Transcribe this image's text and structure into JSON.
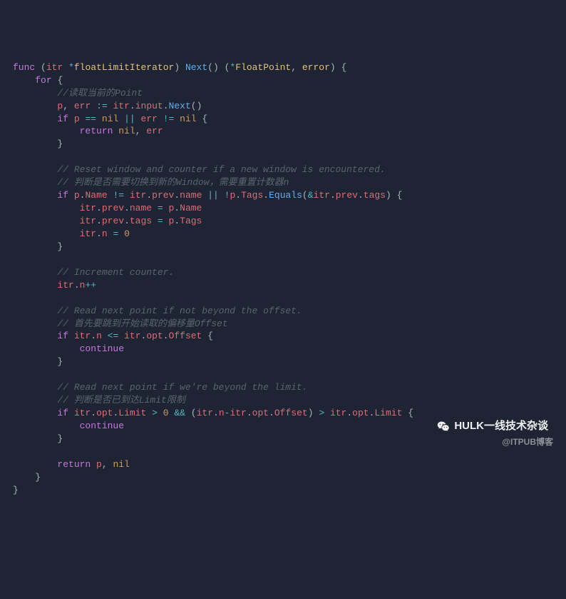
{
  "code": {
    "l01": {
      "func": "func",
      "itr": "itr",
      "star": "*",
      "ty": "floatLimitIterator",
      "next": "Next",
      "lp2": "(",
      "rp2": ")",
      "lpret": "(",
      "star2": "*",
      "tyret": "FloatPoint",
      "comma": ",",
      "err": "error",
      "rpret": ")",
      "ob": "{"
    },
    "l02": {
      "for": "for",
      "ob": "{"
    },
    "l03": {
      "cm": "//读取当前的Point"
    },
    "l04": {
      "p": "p",
      "c1": ",",
      "err": "err",
      "asn": ":=",
      "itr": "itr",
      "d1": ".",
      "input": "input",
      "d2": ".",
      "next": "Next",
      "lp": "(",
      "rp": ")"
    },
    "l05": {
      "if": "if",
      "p": "p",
      "eq": "==",
      "nil1": "nil",
      "or": "||",
      "err": "err",
      "neq": "!=",
      "nil2": "nil",
      "ob": "{"
    },
    "l06": {
      "ret": "return",
      "nil": "nil",
      "c": ",",
      "err": "err"
    },
    "l07": {
      "cb": "}"
    },
    "l09": {
      "cm": "// Reset window and counter if a new window is encountered."
    },
    "l10": {
      "cm": "// 判断是否需要切换到新的Window，需要重置计数器n"
    },
    "l11": {
      "if": "if",
      "p": "p",
      "d1": ".",
      "Name": "Name",
      "ne": "!=",
      "itr": "itr",
      "d2": ".",
      "prev": "prev",
      "d3": ".",
      "name": "name",
      "or": "||",
      "bang": "!",
      "p2": "p",
      "d4": ".",
      "Tags": "Tags",
      "d5": ".",
      "eq": "Equals",
      "lp": "(",
      "amp": "&",
      "itr2": "itr",
      "d6": ".",
      "prev2": "prev",
      "d7": ".",
      "tags": "tags",
      "rp": ")",
      "ob": "{"
    },
    "l12": {
      "itr": "itr",
      "d1": ".",
      "prev": "prev",
      "d2": ".",
      "name": "name",
      "eq": "=",
      "p": "p",
      "d3": ".",
      "Name": "Name"
    },
    "l13": {
      "itr": "itr",
      "d1": ".",
      "prev": "prev",
      "d2": ".",
      "tags": "tags",
      "eq": "=",
      "p": "p",
      "d3": ".",
      "Tags": "Tags"
    },
    "l14": {
      "itr": "itr",
      "d": ".",
      "n": "n",
      "eq": "=",
      "zero": "0"
    },
    "l15": {
      "cb": "}"
    },
    "l17": {
      "cm": "// Increment counter."
    },
    "l18": {
      "itr": "itr",
      "d": ".",
      "n": "n",
      "pp": "++"
    },
    "l20": {
      "cm": "// Read next point if not beyond the offset."
    },
    "l21": {
      "cm": "// 首先要跳到开始读取的偏移量Offset"
    },
    "l22": {
      "if": "if",
      "itr": "itr",
      "d1": ".",
      "n": "n",
      "le": "<=",
      "itr2": "itr",
      "d2": ".",
      "opt": "opt",
      "d3": ".",
      "Offset": "Offset",
      "ob": "{"
    },
    "l23": {
      "cont": "continue"
    },
    "l24": {
      "cb": "}"
    },
    "l26": {
      "cm": "// Read next point if we're beyond the limit."
    },
    "l27": {
      "cm": "// 判断是否已到达Limit限制"
    },
    "l28": {
      "if": "if",
      "itr": "itr",
      "d1": ".",
      "opt": "opt",
      "d2": ".",
      "Limit": "Limit",
      "gt": ">",
      "zero": "0",
      "and": "&&",
      "lp": "(",
      "itr2": "itr",
      "d3": ".",
      "n": "n",
      "minus": "-",
      "itr3": "itr",
      "d4": ".",
      "opt2": "opt",
      "d5": ".",
      "Offset": "Offset",
      "rp": ")",
      "gt2": ">",
      "itr4": "itr",
      "d6": ".",
      "opt3": "opt",
      "d7": ".",
      "Limit2": "Limit",
      "ob": "{"
    },
    "l29": {
      "cont": "continue"
    },
    "l30": {
      "cb": "}"
    },
    "l32": {
      "ret": "return",
      "p": "p",
      "c": ",",
      "nil": "nil"
    },
    "l33": {
      "cb": "}"
    },
    "l34": {
      "cb": "}"
    }
  },
  "watermark1": "HULK一线技术杂谈",
  "watermark2": "@ITPUB博客"
}
